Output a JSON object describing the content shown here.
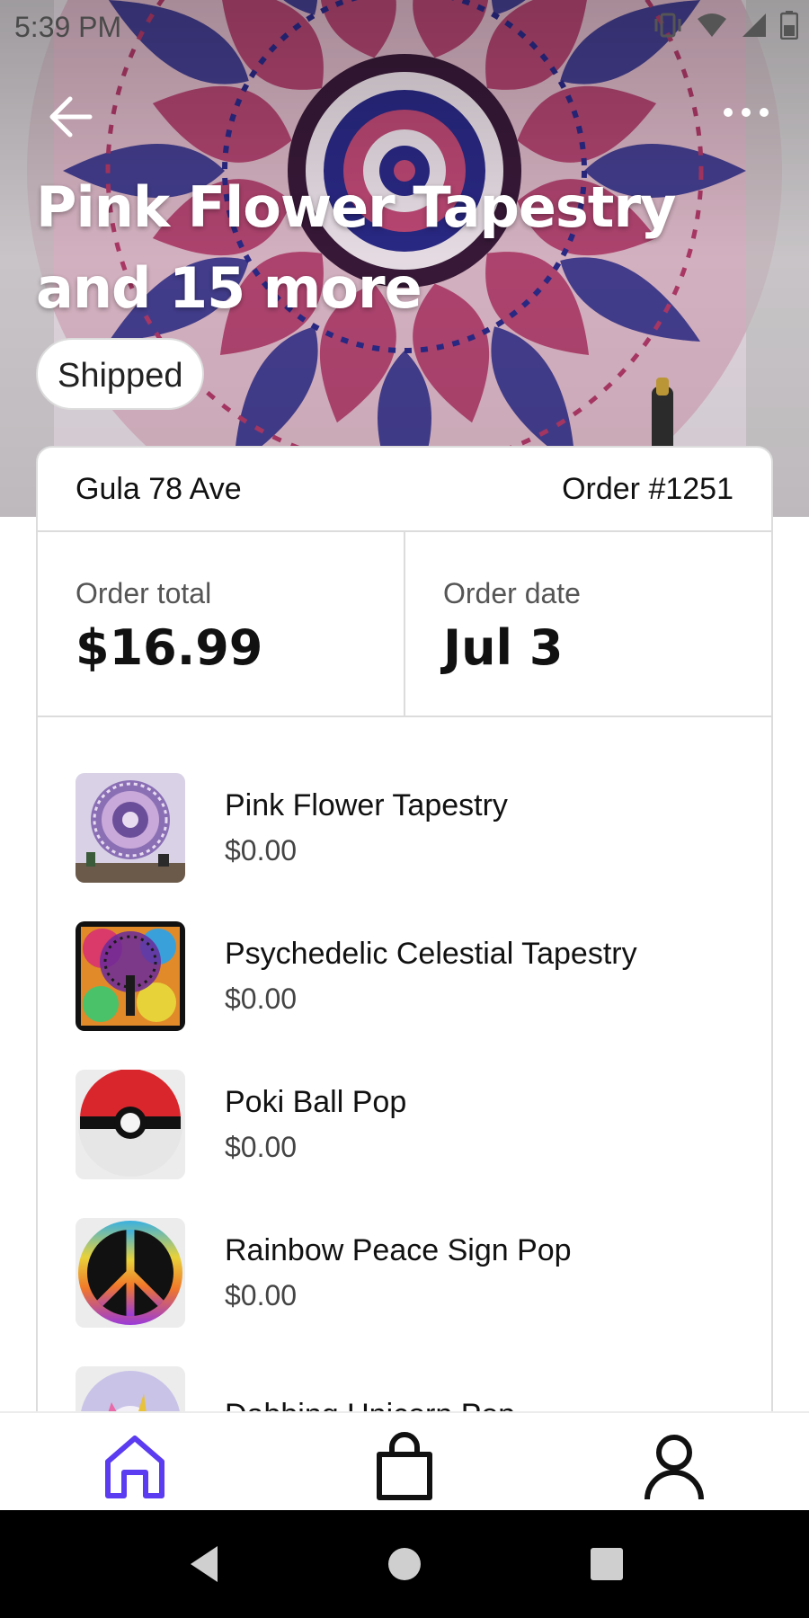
{
  "status_bar": {
    "time": "5:39 PM"
  },
  "header": {
    "title": "Pink Flower Tapestry and 15 more",
    "status_badge": "Shipped",
    "back_icon": "arrow-left-icon",
    "more_icon": "more-horizontal-icon"
  },
  "order": {
    "address": "Gula 78 Ave",
    "number": "Order #1251",
    "total_label": "Order total",
    "total_value": "$16.99",
    "date_label": "Order date",
    "date_value": "Jul 3"
  },
  "items": [
    {
      "name": "Pink Flower Tapestry",
      "price": "$0.00",
      "thumb": "mandala-tapestry"
    },
    {
      "name": "Psychedelic Celestial Tapestry",
      "price": "$0.00",
      "thumb": "tree-tapestry"
    },
    {
      "name": "Poki Ball Pop",
      "price": "$0.00",
      "thumb": "poke-ball"
    },
    {
      "name": "Rainbow Peace Sign Pop",
      "price": "$0.00",
      "thumb": "peace-sign"
    },
    {
      "name": "Dabbing Unicorn Pop",
      "price": "",
      "thumb": "unicorn"
    }
  ],
  "bottom_nav": [
    {
      "icon": "home-icon",
      "active": true
    },
    {
      "icon": "shopping-bag-icon",
      "active": false
    },
    {
      "icon": "user-icon",
      "active": false
    }
  ],
  "colors": {
    "accent": "#5b3cf0",
    "hero_primary": "#b23a6a",
    "hero_secondary": "#2b2a8a"
  }
}
